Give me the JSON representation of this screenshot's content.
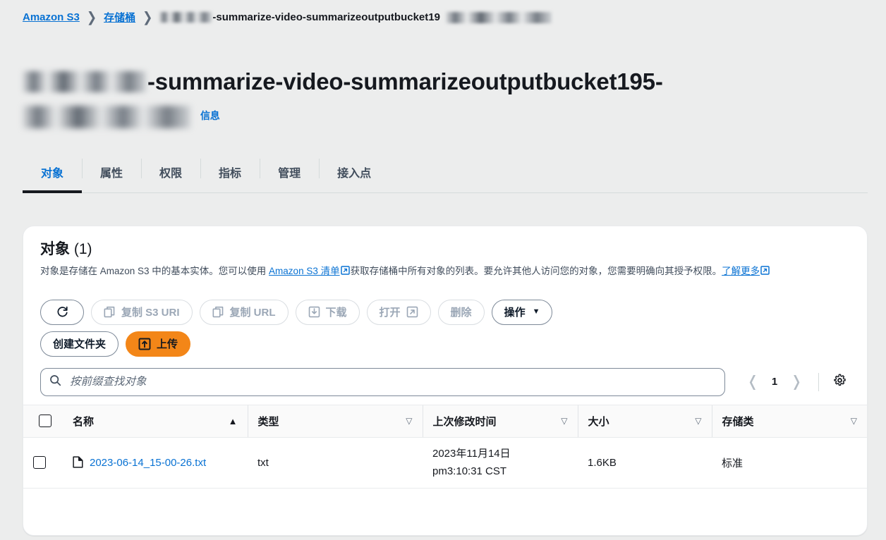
{
  "breadcrumb": {
    "items": [
      {
        "label": "Amazon S3",
        "link": true
      },
      {
        "label": "存储桶",
        "link": true
      }
    ],
    "current": "-summarize-video-summarizeoutputbucket19",
    "separator": "❯"
  },
  "heading": {
    "line1": "-summarize-video-summarizeoutputbucket195-",
    "info_label": "信息"
  },
  "tabs": [
    {
      "label": "对象",
      "active": true
    },
    {
      "label": "属性",
      "active": false
    },
    {
      "label": "权限",
      "active": false
    },
    {
      "label": "指标",
      "active": false
    },
    {
      "label": "管理",
      "active": false
    },
    {
      "label": "接入点",
      "active": false
    }
  ],
  "panel": {
    "title": "对象",
    "count": "(1)",
    "desc_part1": "对象是存储在 Amazon S3 中的基本实体。您可以使用 ",
    "desc_link1": "Amazon S3 清单",
    "desc_part2": "获取存储桶中所有对象的列表。要允许其他人访问您的对象，您需要明确向其授予权限。",
    "desc_link2": "了解更多"
  },
  "toolbar": {
    "refresh_label": "",
    "copy_s3_uri": "复制 S3 URI",
    "copy_url": "复制 URL",
    "download": "下载",
    "open": "打开",
    "delete": "删除",
    "actions": "操作",
    "actions_caret": "▼",
    "create_folder": "创建文件夹",
    "upload": "上传"
  },
  "search": {
    "placeholder": "按前缀查找对象",
    "value": ""
  },
  "pagination": {
    "prev": "❬",
    "page": "1",
    "next": "❭"
  },
  "table": {
    "columns": [
      {
        "label": "名称",
        "sort": "▲",
        "sort_active": true
      },
      {
        "label": "类型",
        "sort": "▽",
        "sort_active": false
      },
      {
        "label": "上次修改时间",
        "sort": "▽",
        "sort_active": false
      },
      {
        "label": "大小",
        "sort": "▽",
        "sort_active": false
      },
      {
        "label": "存储类",
        "sort": "▽",
        "sort_active": false
      }
    ],
    "rows": [
      {
        "name": "2023-06-14_15-00-26.txt",
        "type": "txt",
        "modified_date": "2023年11月14日",
        "modified_time": "pm3:10:31 CST",
        "size": "1.6KB",
        "storage_class": "标准"
      }
    ]
  },
  "colors": {
    "accent_link": "#0972d3",
    "primary_button": "#f38618",
    "page_background": "#eceded",
    "panel_background": "#ffffff"
  }
}
